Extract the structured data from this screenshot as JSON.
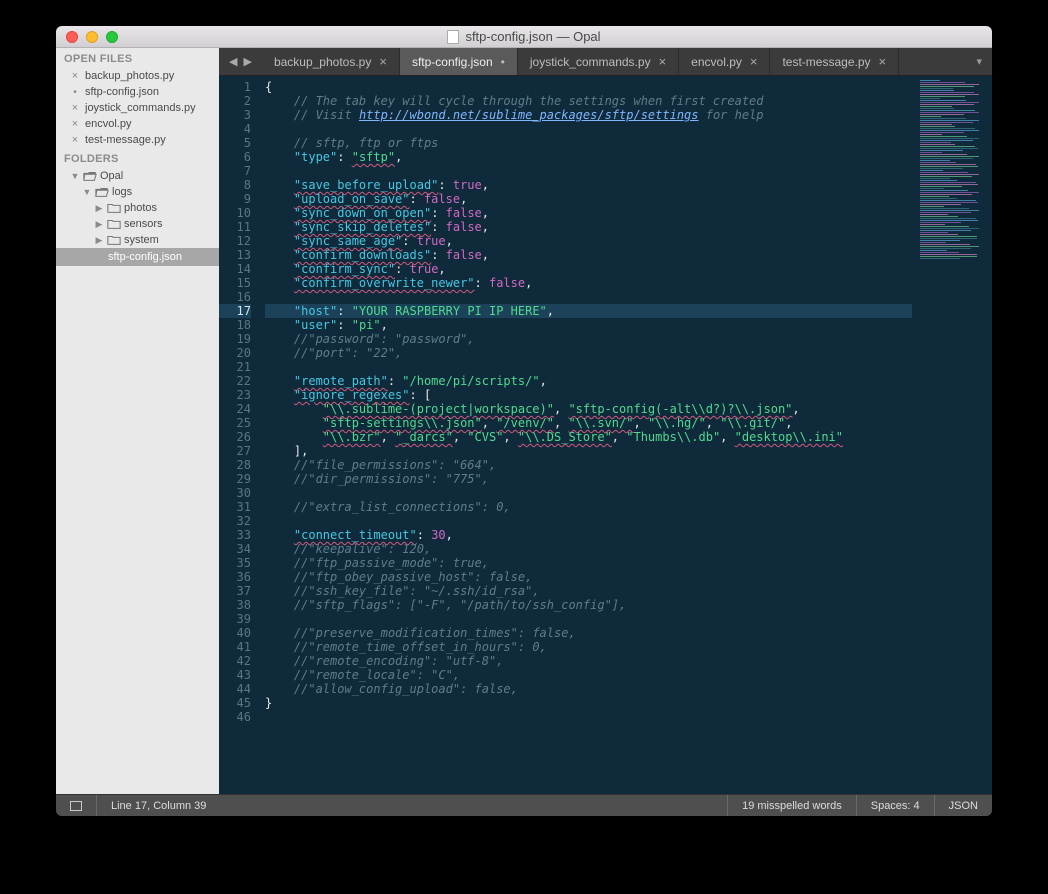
{
  "window": {
    "title": "sftp-config.json — Opal"
  },
  "sidebar": {
    "open_files_label": "OPEN FILES",
    "folders_label": "FOLDERS",
    "open_files": [
      {
        "name": "backup_photos.py",
        "dirty": false
      },
      {
        "name": "sftp-config.json",
        "dirty": true
      },
      {
        "name": "joystick_commands.py",
        "dirty": false
      },
      {
        "name": "encvol.py",
        "dirty": false
      },
      {
        "name": "test-message.py",
        "dirty": false
      }
    ],
    "tree": {
      "root": "Opal",
      "logs": "logs",
      "photos": "photos",
      "sensors": "sensors",
      "system": "system",
      "file": "sftp-config.json"
    }
  },
  "tabs": {
    "items": [
      {
        "label": "backup_photos.py",
        "dirty": false,
        "active": false
      },
      {
        "label": "sftp-config.json",
        "dirty": true,
        "active": true
      },
      {
        "label": "joystick_commands.py",
        "dirty": false,
        "active": false
      },
      {
        "label": "encvol.py",
        "dirty": false,
        "active": false
      },
      {
        "label": "test-message.py",
        "dirty": false,
        "active": false
      }
    ]
  },
  "editor": {
    "active_line": 17,
    "total_lines": 46,
    "comment1": "// The tab key will cycle through the settings when first created",
    "comment2_a": "// Visit ",
    "comment2_link": "http://wbond.net/sublime_packages/sftp/settings",
    "comment2_b": " for help",
    "comment3": "// sftp, ftp or ftps",
    "kv": {
      "type_k": "\"type\"",
      "type_v": "\"sftp\"",
      "sbu_k": "\"save_before_upload\"",
      "sbu_v": "true",
      "uos_k": "\"upload_on_save\"",
      "uos_v": "false",
      "sdo_k": "\"sync_down_on_open\"",
      "sdo_v": "false",
      "ssd_k": "\"sync_skip_deletes\"",
      "ssd_v": "false",
      "ssa_k": "\"sync_same_age\"",
      "ssa_v": "true",
      "cdl_k": "\"confirm_downloads\"",
      "cdl_v": "false",
      "csy_k": "\"confirm_sync\"",
      "csy_v": "true",
      "con_k": "\"confirm_overwrite_newer\"",
      "con_v": "false",
      "host_k": "\"host\"",
      "host_v": "\"YOUR RASPBERRY PI IP HERE\"",
      "user_k": "\"user\"",
      "user_v": "\"pi\"",
      "c_pass": "//\"password\": \"password\",",
      "c_port": "//\"port\": \"22\",",
      "rp_k": "\"remote_path\"",
      "rp_v": "\"/home/pi/scripts/\"",
      "ir_k": "\"ignore_regexes\"",
      "ir_1a": "\"\\\\.sublime-(project|workspace)\"",
      "ir_1b": "\"sftp-config(-alt\\\\d?)?\\\\.json\"",
      "ir_2a": "\"sftp-settings\\\\.json\"",
      "ir_2b": "\"/venv/\"",
      "ir_2c": "\"\\\\.svn/\"",
      "ir_2d": "\"\\\\.hg/\"",
      "ir_2e": "\"\\\\.git/\"",
      "ir_3a": "\"\\\\.bzr\"",
      "ir_3b": "\"_darcs\"",
      "ir_3c": "\"CVS\"",
      "ir_3d": "\"\\\\.DS_Store\"",
      "ir_3e": "\"Thumbs\\\\.db\"",
      "ir_3f": "\"desktop\\\\.ini\"",
      "c_fperm": "//\"file_permissions\": \"664\",",
      "c_dperm": "//\"dir_permissions\": \"775\",",
      "c_extra": "//\"extra_list_connections\": 0,",
      "ct_k": "\"connect_timeout\"",
      "ct_v": "30",
      "c_keep": "//\"keepalive\": 120,",
      "c_fpm": "//\"ftp_passive_mode\": true,",
      "c_foh": "//\"ftp_obey_passive_host\": false,",
      "c_skf": "//\"ssh_key_file\": \"~/.ssh/id_rsa\",",
      "c_sfl": "//\"sftp_flags\": [\"-F\", \"/path/to/ssh_config\"],",
      "c_pmt": "//\"preserve_modification_times\": false,",
      "c_rto": "//\"remote_time_offset_in_hours\": 0,",
      "c_ren": "//\"remote_encoding\": \"utf-8\",",
      "c_rlc": "//\"remote_locale\": \"C\",",
      "c_acu": "//\"allow_config_upload\": false,"
    }
  },
  "status": {
    "pos": "Line 17, Column 39",
    "spell": "19 misspelled words",
    "spaces": "Spaces: 4",
    "syntax": "JSON"
  }
}
